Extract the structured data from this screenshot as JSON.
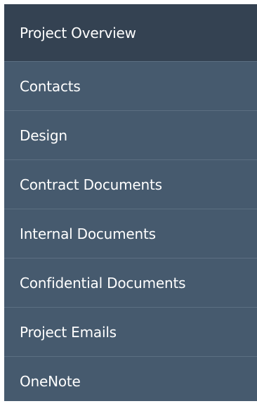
{
  "nav": {
    "header": "Project Overview",
    "items": [
      {
        "label": "Contacts"
      },
      {
        "label": "Design"
      },
      {
        "label": "Contract Documents"
      },
      {
        "label": "Internal Documents"
      },
      {
        "label": "Confidential Documents"
      },
      {
        "label": "Project Emails"
      },
      {
        "label": "OneNote"
      }
    ]
  },
  "colors": {
    "header_bg": "#344252",
    "item_bg": "#465a6e",
    "divider": "#5c6f82",
    "text": "#ffffff"
  }
}
